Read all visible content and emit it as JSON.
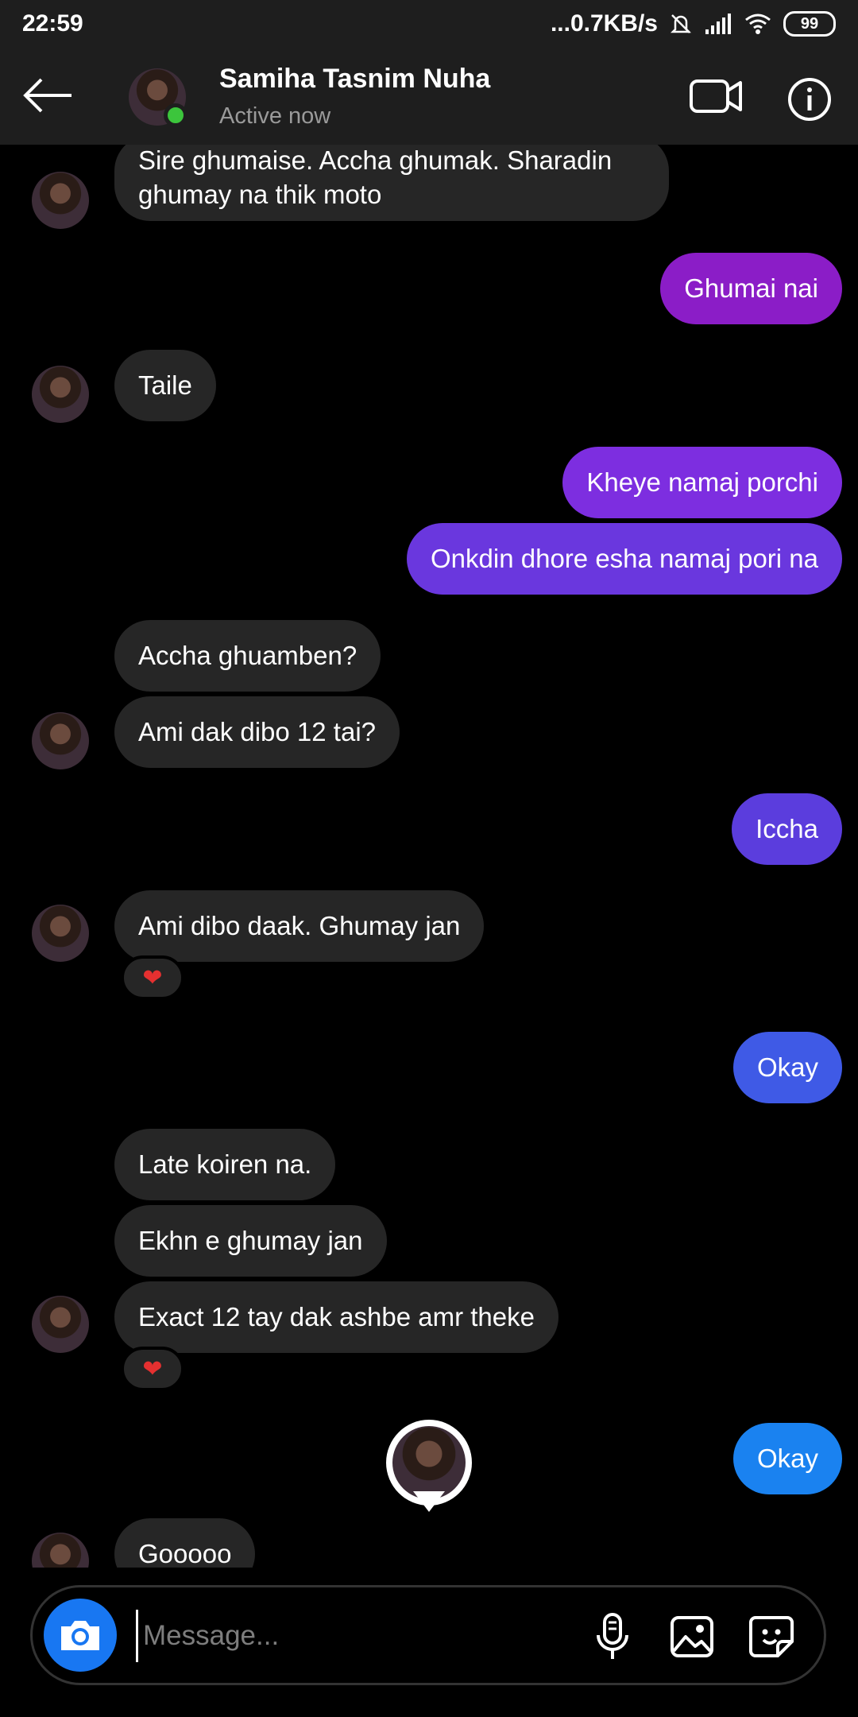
{
  "status_bar": {
    "time": "22:59",
    "net_speed": "...0.7KB/s",
    "battery": "99"
  },
  "header": {
    "name": "Samiha Tasnim Nuha",
    "status": "Active now"
  },
  "messages": [
    {
      "dir": "in",
      "text": "Sire ghumaise. Accha ghumak. Sharadin ghumay na thik moto"
    },
    {
      "dir": "out",
      "text": "Ghumai nai"
    },
    {
      "dir": "in",
      "text": "Taile"
    },
    {
      "dir": "out",
      "text": "Kheye namaj porchi"
    },
    {
      "dir": "out",
      "text": "Onkdin dhore esha namaj pori na"
    },
    {
      "dir": "in",
      "text": "Accha ghuamben?"
    },
    {
      "dir": "in",
      "text": "Ami dak dibo 12 tai?"
    },
    {
      "dir": "out",
      "text": "Iccha"
    },
    {
      "dir": "in",
      "text": "Ami dibo daak. Ghumay jan",
      "reaction": "❤"
    },
    {
      "dir": "out",
      "text": "Okay"
    },
    {
      "dir": "in",
      "text": "Late koiren na."
    },
    {
      "dir": "in",
      "text": "Ekhn e ghumay jan"
    },
    {
      "dir": "in",
      "text": "Exact 12 tay dak ashbe amr theke",
      "reaction": "❤"
    },
    {
      "dir": "out",
      "text": "Okay"
    },
    {
      "dir": "in",
      "text": "Gooooo"
    }
  ],
  "composer": {
    "placeholder": "Message..."
  },
  "colors": {
    "incoming": "#262626",
    "out_1": "#8b1dc7",
    "out_2": "#7d2ee0",
    "out_3": "#6a37de",
    "out_4": "#5b3ddd",
    "out_5": "#3f5ae6",
    "out_6": "#1a82f0"
  }
}
